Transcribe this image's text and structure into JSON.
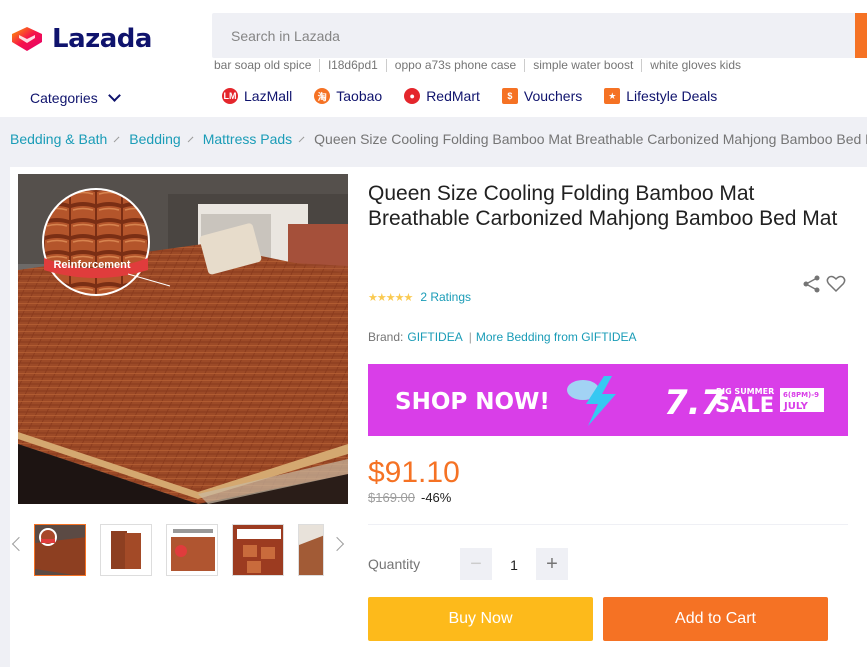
{
  "brand": {
    "logo_text": "Lazada"
  },
  "search": {
    "placeholder": "Search in Lazada"
  },
  "suggestions": [
    "bar soap old spice",
    "l18d6pd1",
    "oppo a73s phone case",
    "simple water boost",
    "white gloves kids"
  ],
  "nav": {
    "categories_label": "Categories",
    "links": [
      {
        "label": "LazMall",
        "icon": "lazmall-icon",
        "color": "#e4262c"
      },
      {
        "label": "Taobao",
        "icon": "taobao-icon",
        "color": "#f57224"
      },
      {
        "label": "RedMart",
        "icon": "redmart-icon",
        "color": "#e4262c"
      },
      {
        "label": "Vouchers",
        "icon": "voucher-icon",
        "color": "#f57224"
      },
      {
        "label": "Lifestyle Deals",
        "icon": "lifestyle-icon",
        "color": "#f57224"
      }
    ]
  },
  "breadcrumb": [
    "Bedding & Bath",
    "Bedding",
    "Mattress Pads",
    "Queen Size Cooling Folding Bamboo Mat Breathable Carbonized Mahjong Bamboo Bed Mat"
  ],
  "product": {
    "title": "Queen Size Cooling Folding Bamboo Mat Breathable Carbonized Mahjong Bamboo Bed Mat",
    "image_badge": "Reinforcement",
    "rating_stars": 5,
    "ratings_text": "2 Ratings",
    "brand_label": "Brand:",
    "brand_name": "GIFTIDEA",
    "more_from": "More Bedding from GIFTIDEA",
    "price": "$91.10",
    "original_price": "$169.00",
    "discount": "-46%",
    "quantity_label": "Quantity",
    "quantity": "1",
    "buy_label": "Buy Now",
    "cart_label": "Add to Cart"
  },
  "banner": {
    "shop_now": "SHOP NOW!",
    "big_number": "7.7",
    "big_summer": "BIG SUMMER",
    "sale": "SALE",
    "dates_top": "6(8PM)-9",
    "dates_bottom": "JULY"
  },
  "colors": {
    "accent": "#f57224",
    "link": "#1a9cb7",
    "navy": "#0f136d",
    "buy": "#fdba1b",
    "banner": "#d93ee8"
  }
}
